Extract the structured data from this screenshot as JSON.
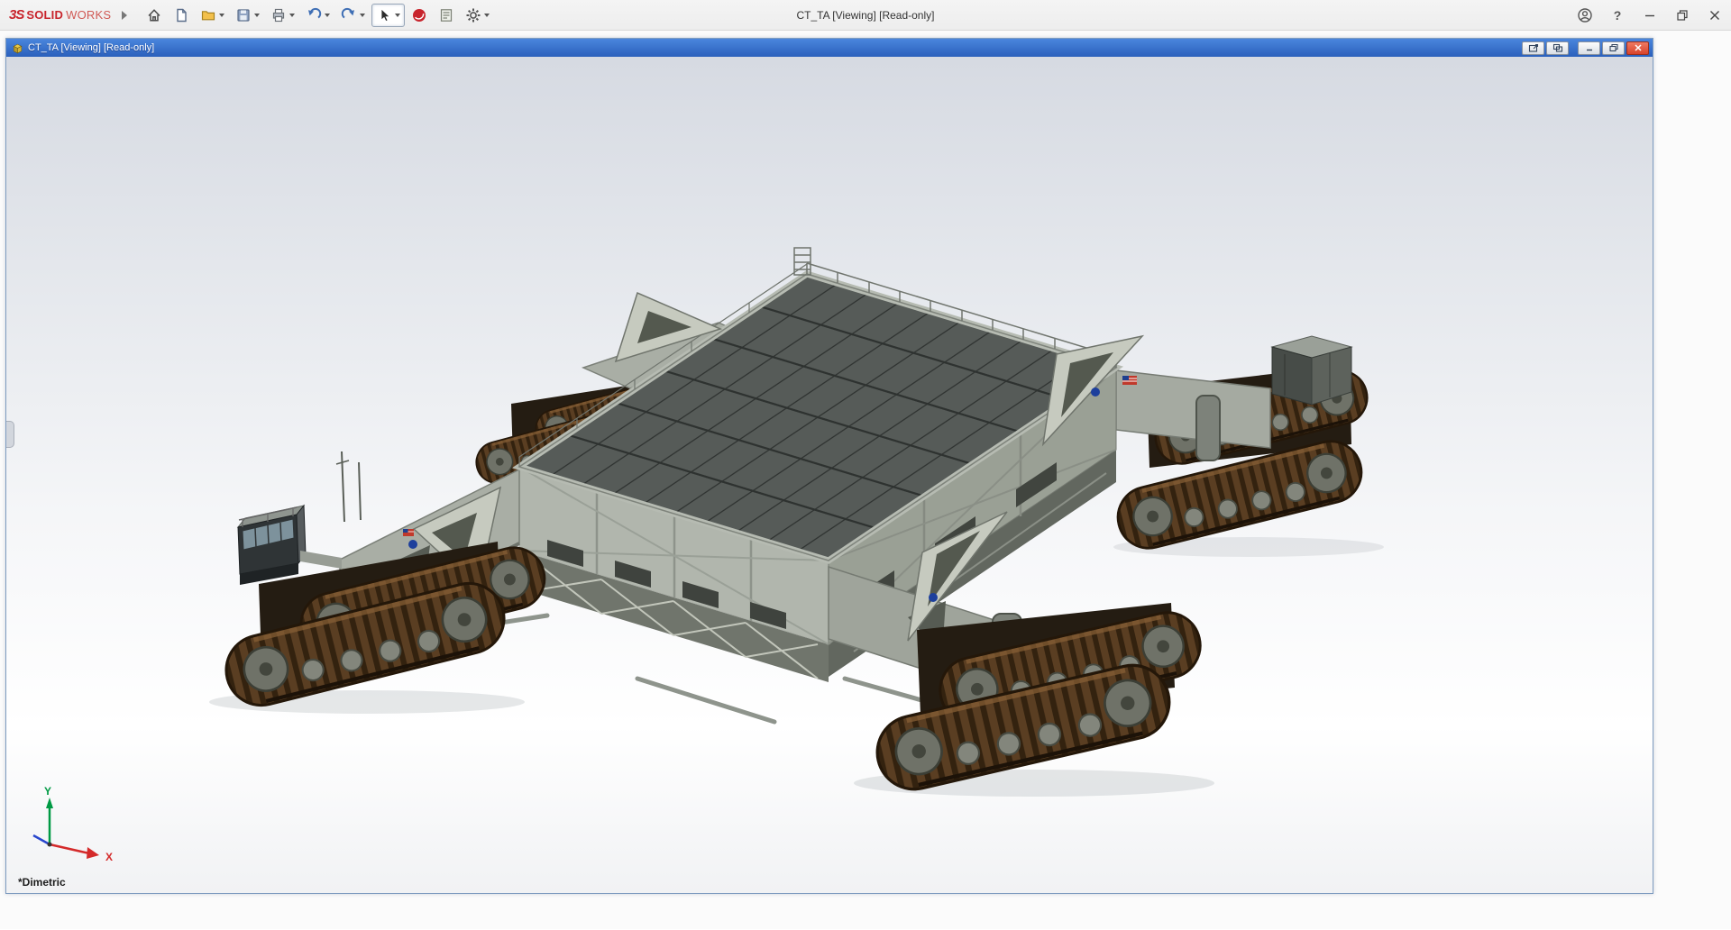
{
  "app": {
    "logo_mark": "3S",
    "logo_solid": "SOLID",
    "logo_works": "WORKS",
    "window_title": "CT_TA [Viewing] [Read-only]",
    "help_glyph": "?"
  },
  "toolbar": {
    "icons": [
      "home-icon",
      "new-document-icon",
      "open-icon",
      "save-icon",
      "print-icon",
      "undo-icon",
      "redo-icon",
      "select-cursor-icon",
      "3dexperience-icon",
      "evaluate-icon",
      "options-gear-icon"
    ],
    "right_icons": [
      "account-icon",
      "help-icon",
      "minimize-icon",
      "maximize-icon",
      "close-icon"
    ]
  },
  "document": {
    "title": "CT_TA [Viewing] [Read-only]",
    "controls": [
      "pop-out-window",
      "pop-out-all",
      "minimize",
      "restore",
      "close"
    ]
  },
  "viewport": {
    "view_orientation": "*Dimetric",
    "triad": {
      "x_label": "X",
      "y_label": "Y"
    }
  },
  "colors": {
    "titlebar_blue": "#2b60bc",
    "close_red": "#d8432c",
    "brand_red": "#c8242c",
    "deck_gray": "#565b58",
    "body_gray": "#aeb3ab",
    "track_brown": "#5a3e22",
    "triad_x_red": "#d42a2a",
    "triad_y_green": "#009a44"
  }
}
